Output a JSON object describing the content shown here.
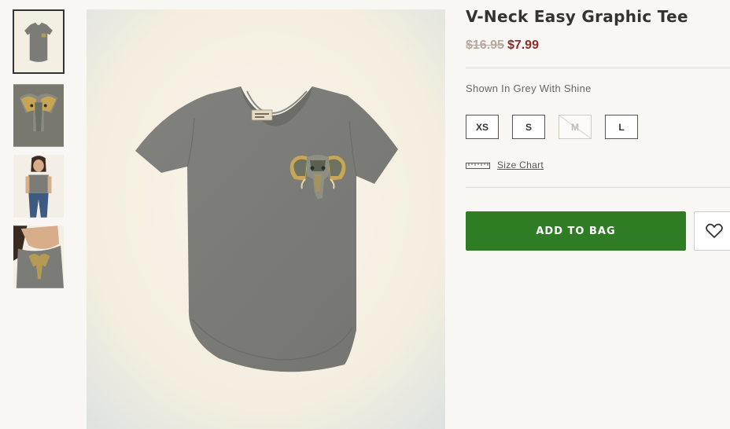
{
  "gallery": {
    "thumbnails": [
      {
        "name": "flat-front-thumbnail",
        "active": true
      },
      {
        "name": "graphic-closeup-thumbnail",
        "active": false
      },
      {
        "name": "model-front-thumbnail",
        "active": false
      },
      {
        "name": "model-detail-thumbnail",
        "active": false
      }
    ]
  },
  "product": {
    "title": "V-Neck Easy Graphic Tee",
    "price_original": "$16.95",
    "price_sale": "$7.99",
    "color_label": "Shown In Grey With Shine",
    "sizes": [
      {
        "label": "XS",
        "available": true
      },
      {
        "label": "S",
        "available": true
      },
      {
        "label": "M",
        "available": false
      },
      {
        "label": "L",
        "available": true
      }
    ],
    "size_chart_label": "Size Chart",
    "add_to_bag_label": "ADD TO BAG"
  },
  "icons": {
    "size_chart": "ruler-icon",
    "wishlist": "heart-icon"
  },
  "colors": {
    "accent_green": "#2e7d24",
    "sale_red": "#8c2a2a",
    "original_price": "#b4a89f",
    "tee_grey": "#7b7b78"
  }
}
